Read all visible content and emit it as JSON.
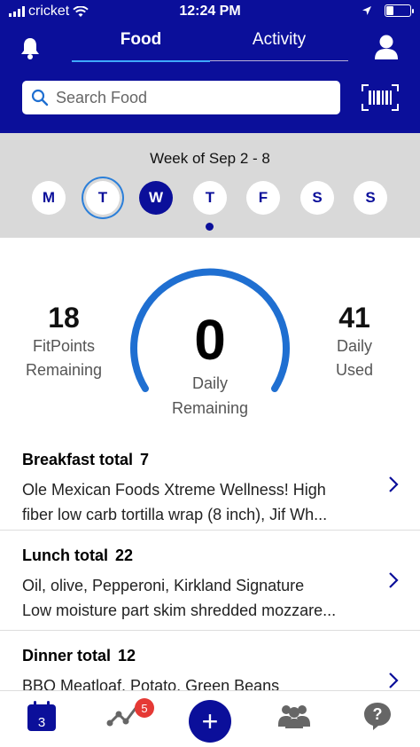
{
  "status": {
    "carrier": "cricket",
    "time": "12:24 PM"
  },
  "nav": {
    "tabs": [
      "Food",
      "Activity"
    ],
    "active_tab": "Food"
  },
  "search": {
    "placeholder": "Search Food"
  },
  "week": {
    "label": "Week of Sep 2 - 8",
    "days": [
      "M",
      "T",
      "W",
      "T",
      "F",
      "S",
      "S"
    ],
    "today_index": 1,
    "selected_index": 2
  },
  "summary": {
    "left": {
      "value": "18",
      "label_line1": "FitPoints",
      "label_line2": "Remaining"
    },
    "center": {
      "value": "0",
      "label_line1": "Daily",
      "label_line2": "Remaining"
    },
    "right": {
      "value": "41",
      "label_line1": "Daily",
      "label_line2": "Used"
    }
  },
  "meals": [
    {
      "title": "Breakfast total",
      "total": "7",
      "line1": "Ole Mexican Foods Xtreme Wellness! High",
      "line2": "fiber low carb tortilla wrap (8 inch), Jif Wh..."
    },
    {
      "title": "Lunch total",
      "total": "22",
      "line1": "Oil, olive, Pepperoni, Kirkland Signature",
      "line2": "Low moisture part skim shredded mozzare..."
    },
    {
      "title": "Dinner total",
      "total": "12",
      "line1": "BBQ Meatloaf, Potato, Green Beans",
      "line2": ""
    }
  ],
  "tabbar": {
    "calendar_day": "3",
    "trend_badge": "5",
    "add_symbol": "+"
  },
  "colors": {
    "brand": "#0b0f9a",
    "accent": "#2b7fd9",
    "gauge": "#1f6fd1",
    "badge": "#e53935",
    "week_bg": "#d9d9d9"
  },
  "icons": [
    "bell-icon",
    "profile-icon",
    "search-icon",
    "barcode-icon",
    "chevron-right-icon",
    "calendar-icon",
    "trend-icon",
    "plus-icon",
    "group-icon",
    "help-icon"
  ]
}
